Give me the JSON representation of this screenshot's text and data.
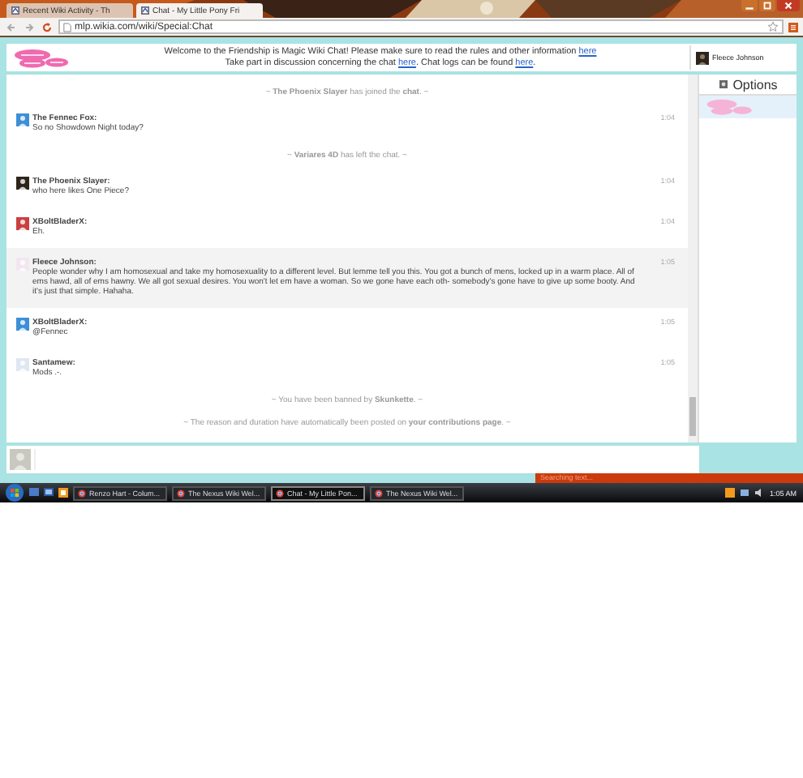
{
  "browser": {
    "tabs": [
      {
        "title": "Recent Wiki Activity - Th",
        "selected": false
      },
      {
        "title": "Chat - My Little Pony Fri",
        "selected": true
      }
    ],
    "url": "mlp.wikia.com/wiki/Special:Chat"
  },
  "header": {
    "welcome": [
      [
        {
          "text": "Welcome to the Friendship is Magic Wiki Chat! Please make sure to read the rules and other information ",
          "link": false
        },
        {
          "text": "here",
          "link": true
        }
      ],
      [
        {
          "text": "Take part in discussion concerning the chat ",
          "link": false
        },
        {
          "text": "here",
          "link": true
        },
        {
          "text": ". Chat logs can be found ",
          "link": false
        },
        {
          "text": "here",
          "link": true
        },
        {
          "text": ".",
          "link": false
        }
      ]
    ],
    "user": "Fleece Johnson"
  },
  "options": "Options",
  "messages": [
    {
      "kind": "inline",
      "text": "~ **The Phoenix Slayer** has joined the **chat**. ~"
    },
    {
      "kind": "message",
      "name": "The Fennec Fox:",
      "text": "So no Showdown Night today?",
      "time": "1:04",
      "highlighted": false
    },
    {
      "kind": "inline",
      "text": "~ **Variares 4D** has left the chat. ~"
    },
    {
      "kind": "message",
      "name": "The Phoenix Slayer:",
      "text": "who here likes One Piece?",
      "time": "1:04",
      "highlighted": false
    },
    {
      "kind": "message",
      "name": "XBoltBladerX:",
      "text": "Eh.",
      "time": "1:04",
      "highlighted": false
    },
    {
      "kind": "message",
      "name": "Fleece Johnson:",
      "text": "People wonder why I am homosexual and take my homosexuality to a different level. But lemme tell you this. You got a bunch of mens, locked up in a warm place. All of ems hawd, all of ems hawny. We all got sexual desires. You won't let em have a woman. So we gone have each oth- somebody's gone have to give up some booty. And it's just that simple. Hahaha.",
      "time": "1:05",
      "highlighted": true
    },
    {
      "kind": "message",
      "name": "XBoltBladerX:",
      "text": "@Fennec",
      "time": "1:05",
      "highlighted": false
    },
    {
      "kind": "message",
      "name": "Santamew:",
      "text": "Mods .-.",
      "time": "1:05",
      "highlighted": false
    },
    {
      "kind": "inline",
      "text": "~ You have been banned by **Skunkette**. ~"
    },
    {
      "kind": "inline",
      "text": "~ The reason and duration have automatically been posted on **your contributions page**. ~"
    }
  ],
  "notice": "Searching text...",
  "taskbar": {
    "items": [
      {
        "title": "Renzo Hart - Colum...",
        "selected": false
      },
      {
        "title": "The Nexus Wiki Wel...",
        "selected": false
      },
      {
        "title": "Chat - My Little Pon...",
        "selected": true
      },
      {
        "title": "The Nexus Wiki Wel...",
        "selected": false
      }
    ],
    "clock": "1:05 AM"
  }
}
